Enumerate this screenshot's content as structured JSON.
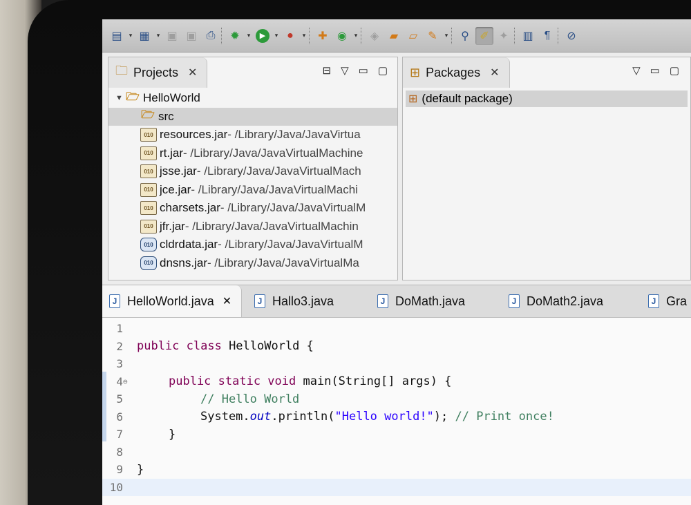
{
  "toolbar": {
    "icons": [
      "new-wizard-icon",
      "new-java-project-icon",
      "save-icon",
      "save-all-icon",
      "print-icon",
      "debug-icon",
      "run-icon",
      "coverage-icon",
      "new-java-package-icon",
      "new-java-class-icon",
      "open-type-icon",
      "open-task-icon",
      "search-icon",
      "external-tools-icon",
      "toggle-breadpoint-icon",
      "mark-occurrences-icon",
      "block-selection-icon",
      "show-whitespace-icon",
      "pin-icon"
    ]
  },
  "projects_view": {
    "title": "Projects",
    "tree": [
      {
        "name": "HelloWorld",
        "path": "",
        "kind": "project"
      },
      {
        "name": "src",
        "path": "",
        "kind": "source-folder"
      },
      {
        "name": "resources.jar",
        "path": " - /Library/Java/JavaVirtua",
        "kind": "jar"
      },
      {
        "name": "rt.jar",
        "path": " - /Library/Java/JavaVirtualMachine",
        "kind": "jar"
      },
      {
        "name": "jsse.jar",
        "path": " - /Library/Java/JavaVirtualMach",
        "kind": "jar"
      },
      {
        "name": "jce.jar",
        "path": " - /Library/Java/JavaVirtualMachi",
        "kind": "jar"
      },
      {
        "name": "charsets.jar",
        "path": " - /Library/Java/JavaVirtualM",
        "kind": "jar"
      },
      {
        "name": "jfr.jar",
        "path": " - /Library/Java/JavaVirtualMachin",
        "kind": "jar"
      },
      {
        "name": "cldrdata.jar",
        "path": " - /Library/Java/JavaVirtualM",
        "kind": "ext-jar"
      },
      {
        "name": "dnsns.jar",
        "path": " - /Library/Java/JavaVirtualMa",
        "kind": "ext-jar"
      }
    ]
  },
  "packages_view": {
    "title": "Packages",
    "items": [
      "(default package)"
    ]
  },
  "editor": {
    "tabs": [
      "HelloWorld.java",
      "Hallo3.java",
      "DoMath.java",
      "DoMath2.java",
      "Gra"
    ],
    "active_tab": "HelloWorld.java",
    "lines": [
      {
        "n": "1"
      },
      {
        "n": "2"
      },
      {
        "n": "3"
      },
      {
        "n": "4"
      },
      {
        "n": "5"
      },
      {
        "n": "6"
      },
      {
        "n": "7"
      },
      {
        "n": "8"
      },
      {
        "n": "9"
      },
      {
        "n": "10"
      }
    ],
    "code": {
      "l2_kw": "public class",
      "l2_rest": " HelloWorld {",
      "l4_kw": "public static void",
      "l4_rest": " main(String[] args) {",
      "l5_cm": "// Hello World",
      "l6_a": "System.",
      "l6_field": "out",
      "l6_b": ".println(",
      "l6_str": "\"Hello world!\"",
      "l6_c": "); ",
      "l6_cm": "// Print once!",
      "l7": "}",
      "l9": "}"
    }
  }
}
